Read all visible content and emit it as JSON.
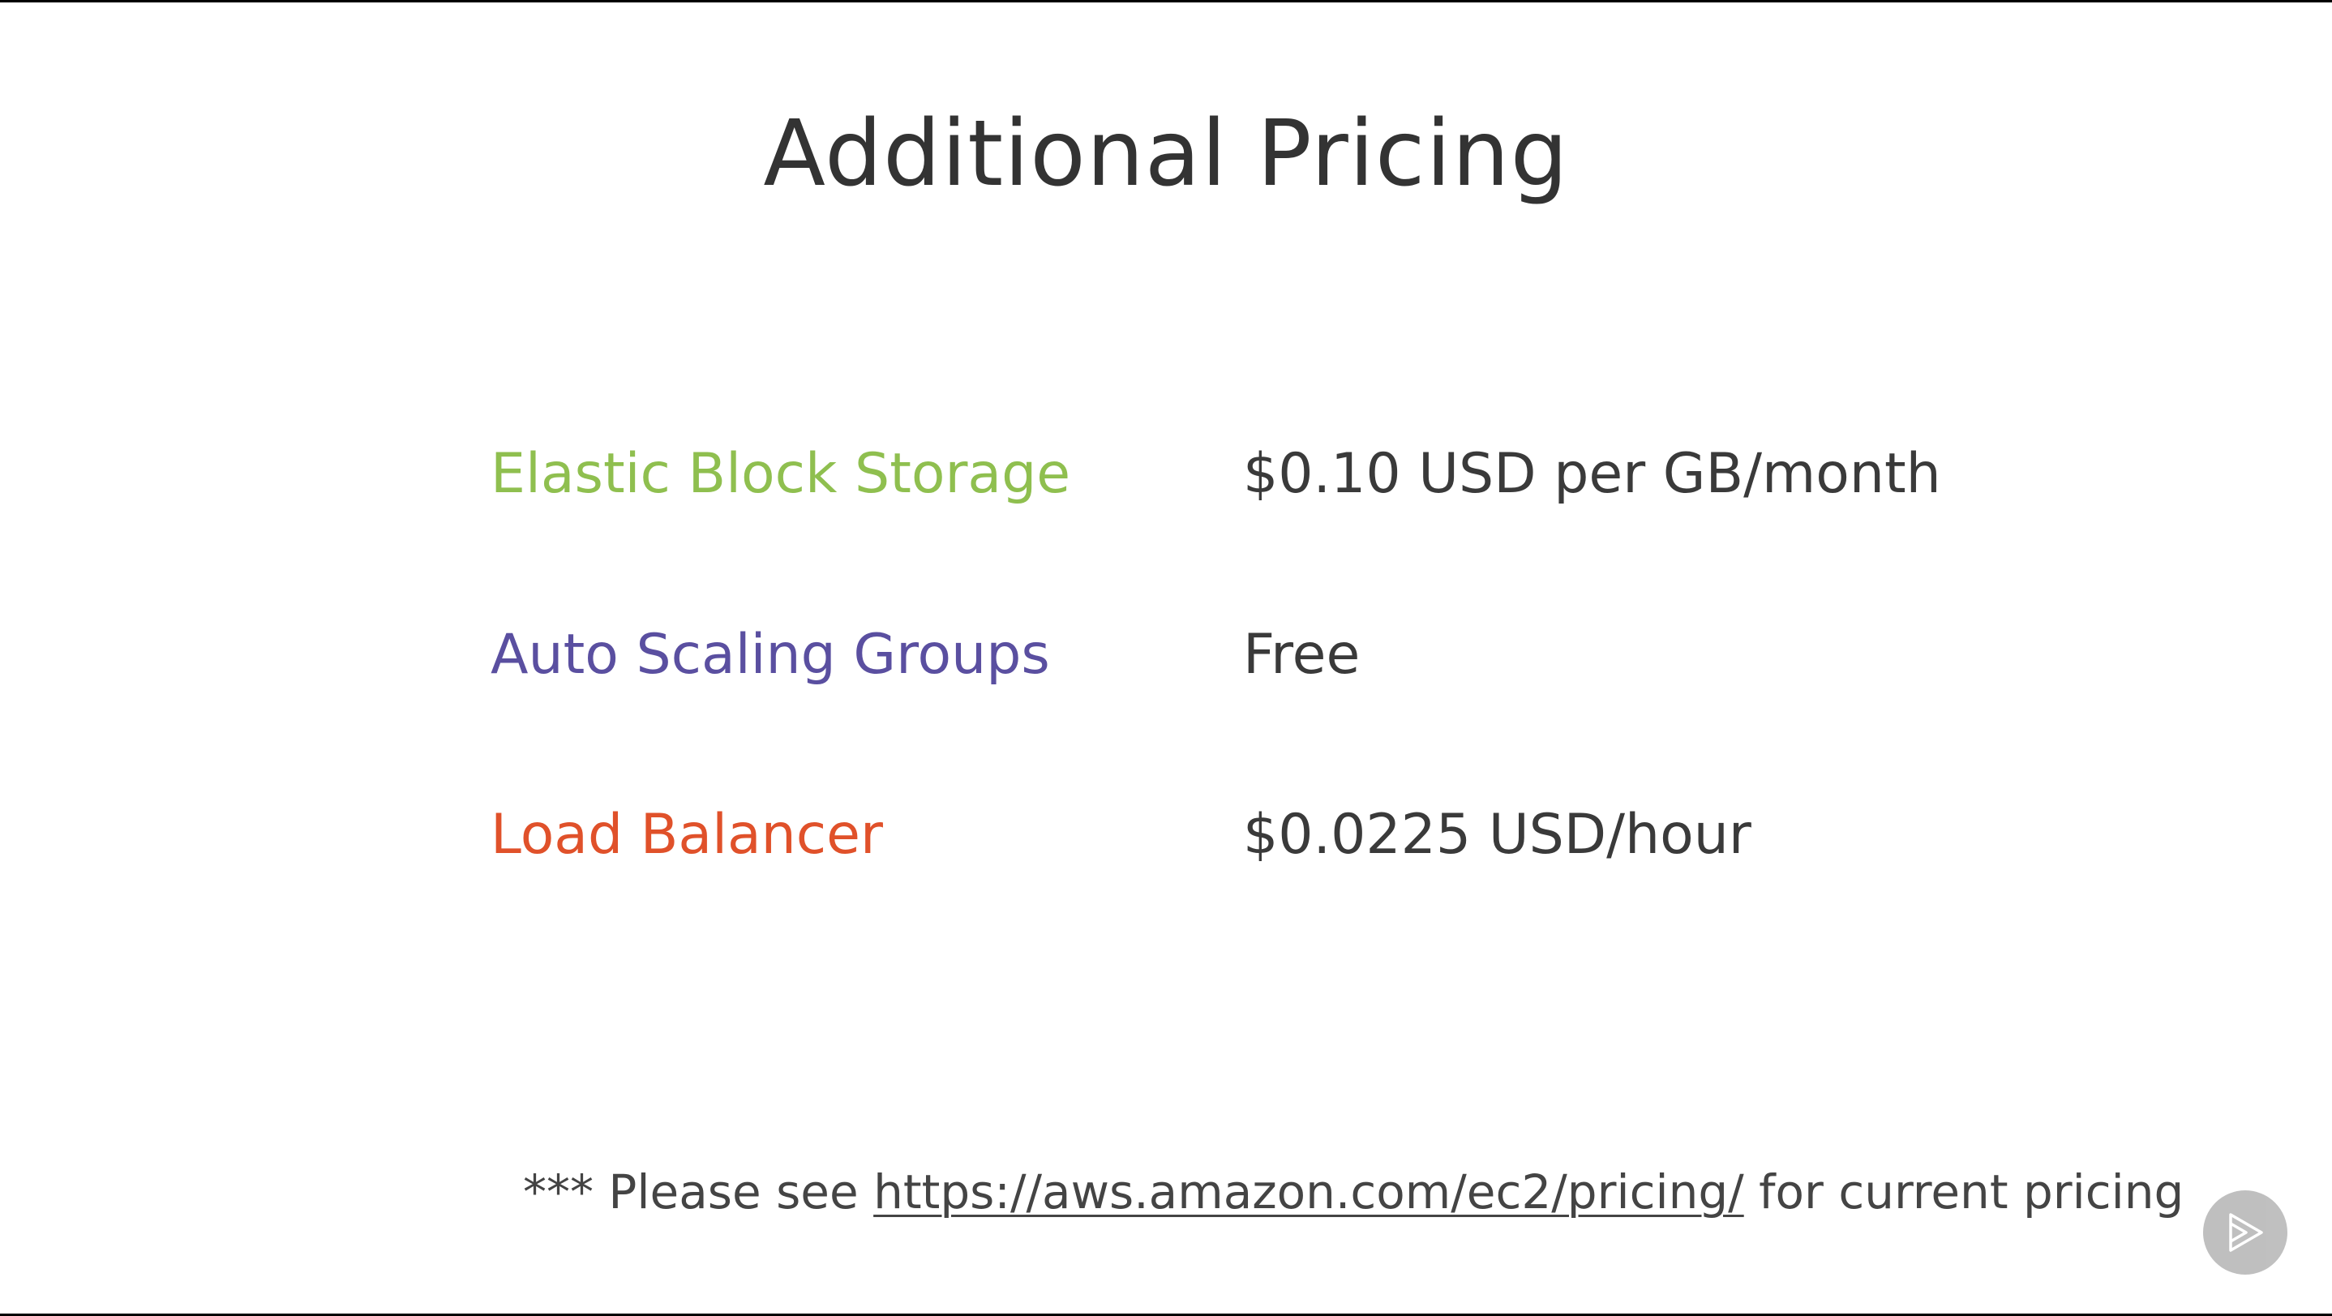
{
  "slide": {
    "title": "Additional Pricing"
  },
  "pricing": {
    "rows": [
      {
        "label": "Elastic Block Storage",
        "value": "$0.10 USD per GB/month",
        "color": "#8fbf4f"
      },
      {
        "label": "Auto Scaling Groups",
        "value": "Free",
        "color": "#5a4fa0"
      },
      {
        "label": "Load Balancer",
        "value": "$0.0225 USD/hour",
        "color": "#e0512a"
      }
    ]
  },
  "footnote": {
    "prefix": "*** Please see ",
    "link_text": "https://aws.amazon.com/ec2/pricing/",
    "suffix": " for current pricing"
  },
  "player": {
    "icon": "play-logo-icon"
  }
}
